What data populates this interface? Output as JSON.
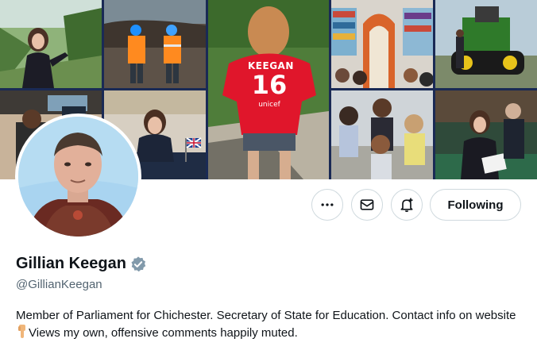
{
  "profile": {
    "name": "Gillian Keegan",
    "handle": "@GillianKeegan",
    "bio_part1": "Member of Parliament for Chichester. Secretary of State for Education. Contact info on website",
    "bio_emoji": "point-down-emoji",
    "bio_part2": "Views my own, offensive comments happily muted.",
    "verified": true
  },
  "actions": {
    "more_icon": "more-icon",
    "message_icon": "envelope-icon",
    "notify_icon": "bell-plus-icon",
    "follow_label": "Following"
  },
  "banner": {
    "jersey_name": "KEEGAN",
    "jersey_number": "16",
    "jersey_logo": "unicef"
  },
  "colors": {
    "banner_bg": "#1a2a55",
    "verified_blue": "#829aab",
    "jersey_red": "#e0162b",
    "handle_gray": "#536471"
  }
}
